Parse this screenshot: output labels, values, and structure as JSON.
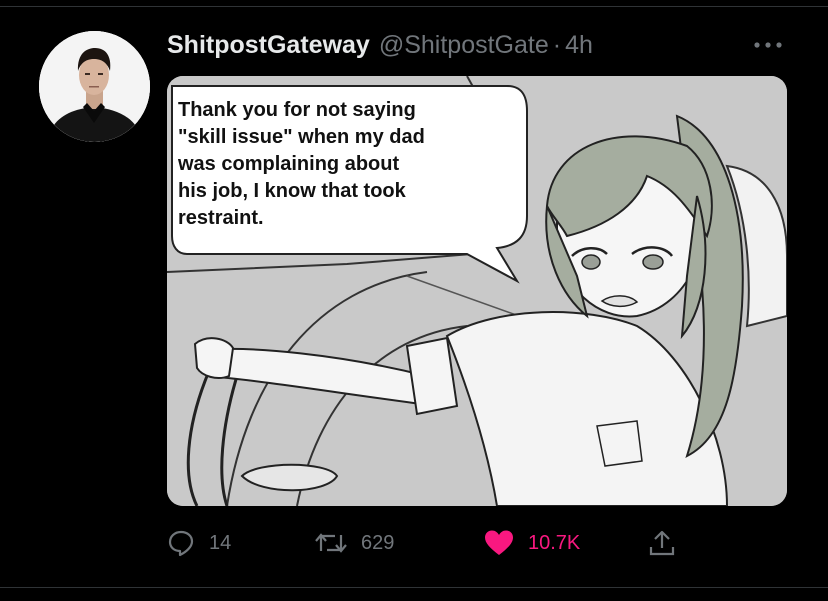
{
  "tweet": {
    "display_name": "ShitpostGateway",
    "handle": "@ShitpostGate",
    "separator": "·",
    "time": "4h",
    "bubble_text": "Thank you for not saying\n\"skill issue\" when my dad\nwas complaining about\nhis job, I know that took\nrestraint."
  },
  "actions": {
    "replies": "14",
    "retweets": "629",
    "likes": "10.7K"
  },
  "icons": {
    "reply": "reply-icon",
    "retweet": "retweet-icon",
    "like": "heart-icon",
    "share": "share-icon",
    "more": "more-icon"
  },
  "colors": {
    "background": "#000000",
    "name": "#e7e9ea",
    "muted": "#71767b",
    "like": "#f91880",
    "hair": "#a5ad9f"
  }
}
